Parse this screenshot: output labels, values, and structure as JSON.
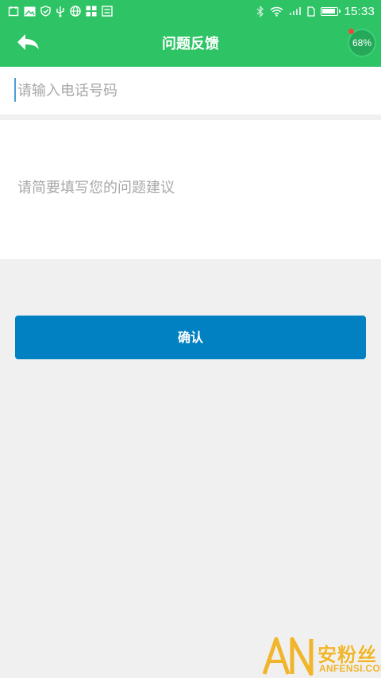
{
  "status_bar": {
    "time": "15:33",
    "left_icons": [
      "calendar-icon",
      "image-icon",
      "shield-icon",
      "usb-icon",
      "globe-icon",
      "apps-icon",
      "sync-icon"
    ],
    "right_icons": [
      "bluetooth-icon",
      "wifi-icon",
      "signal-icon",
      "sim-icon",
      "battery-icon"
    ]
  },
  "header": {
    "title": "问题反馈",
    "back_icon": "back-arrow-icon",
    "perf_badge": "68%"
  },
  "form": {
    "phone_placeholder": "请输入电话号码",
    "phone_value": "",
    "suggestion_placeholder": "请简要填写您的问题建议",
    "suggestion_value": "",
    "confirm_label": "确认"
  },
  "watermark": {
    "logo_letters": "AN",
    "cn_text": "安粉丝",
    "en_text": "ANFENSI.COM"
  },
  "colors": {
    "brand_green": "#2ec466",
    "confirm_blue": "#0281c2",
    "page_bg": "#f0f0f0",
    "watermark_gold": "#f0b52a"
  }
}
